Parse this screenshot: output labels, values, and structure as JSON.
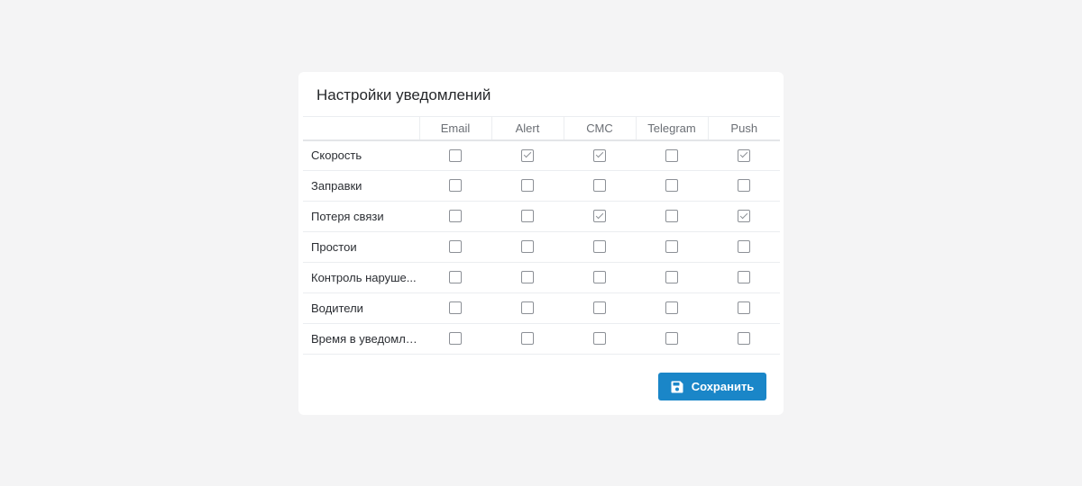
{
  "panel": {
    "title": "Настройки уведомлений"
  },
  "columns": [
    "Email",
    "Alert",
    "СМС",
    "Telegram",
    "Push"
  ],
  "rows": [
    {
      "label": "Скорость",
      "checks": [
        false,
        true,
        true,
        false,
        true
      ]
    },
    {
      "label": "Заправки",
      "checks": [
        false,
        false,
        false,
        false,
        false
      ]
    },
    {
      "label": "Потеря связи",
      "checks": [
        false,
        false,
        true,
        false,
        true
      ]
    },
    {
      "label": "Простои",
      "checks": [
        false,
        false,
        false,
        false,
        false
      ]
    },
    {
      "label": "Контроль наруше...",
      "checks": [
        false,
        false,
        false,
        false,
        false
      ]
    },
    {
      "label": "Водители",
      "checks": [
        false,
        false,
        false,
        false,
        false
      ]
    },
    {
      "label": "Время в уведомле...",
      "checks": [
        false,
        false,
        false,
        false,
        false
      ]
    }
  ],
  "actions": {
    "save_label": "Сохранить",
    "save_icon": "floppy-disk-icon"
  },
  "colors": {
    "accent": "#1a86c8",
    "background": "#f4f4f5",
    "card": "#ffffff"
  }
}
